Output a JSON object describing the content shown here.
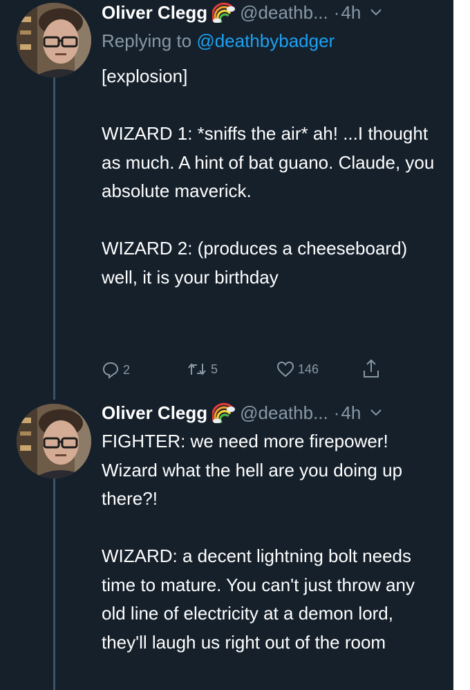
{
  "tweets": [
    {
      "author_name": "Oliver Clegg",
      "handle": "@deathb...",
      "separator": "·",
      "time": "4h",
      "replying_prefix": "Replying to",
      "replying_handle": "@deathbybadger",
      "paragraphs": [
        "[explosion]",
        "WIZARD 1: *sniffs the air* ah! ...I thought as much. A hint of bat guano. Claude, you absolute maverick.",
        "WIZARD 2: (produces a cheeseboard) well, it is your birthday"
      ],
      "actions": {
        "replies": "2",
        "retweets": "5",
        "likes": "146"
      }
    },
    {
      "author_name": "Oliver Clegg",
      "handle": "@deathb...",
      "separator": "·",
      "time": "4h",
      "paragraphs": [
        "FIGHTER: we need more firepower! Wizard what the hell are you doing up there?!",
        "WIZARD: a decent lightning bolt needs time to mature. You can't just throw any old line of electricity at a demon lord, they'll laugh us right out of the room"
      ]
    }
  ],
  "icons": {
    "badge": "rainbow-emoji-icon",
    "menu": "chevron-down-icon",
    "reply": "reply-icon",
    "retweet": "retweet-icon",
    "like": "heart-icon",
    "share": "share-icon"
  },
  "colors": {
    "background": "#15202b",
    "text": "#ffffff",
    "secondary": "#8899a6",
    "link": "#1da1f2",
    "thread_line": "#3d5466"
  }
}
